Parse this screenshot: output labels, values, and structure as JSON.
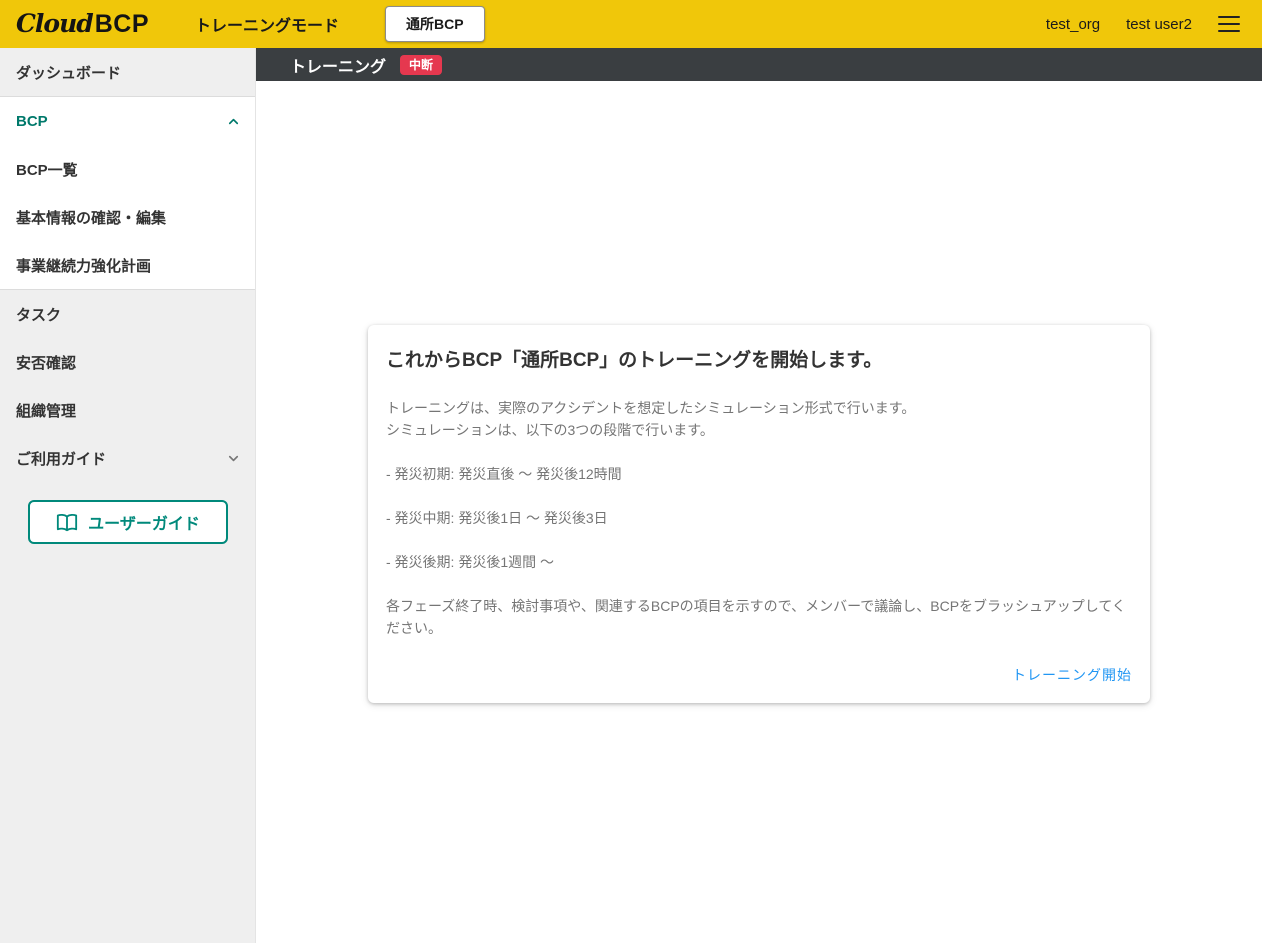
{
  "header": {
    "logo_cloud": "Cloud",
    "logo_bcp": "BCP",
    "mode_label": "トレーニングモード",
    "bcp_button": "通所BCP",
    "org_name": "test_org",
    "user_name": "test user2"
  },
  "sidebar": {
    "items": [
      {
        "label": "ダッシュボード"
      },
      {
        "label": "BCP"
      },
      {
        "label": "BCP一覧"
      },
      {
        "label": "基本情報の確認・編集"
      },
      {
        "label": "事業継続力強化計画"
      },
      {
        "label": "タスク"
      },
      {
        "label": "安否確認"
      },
      {
        "label": "組織管理"
      },
      {
        "label": "ご利用ガイド"
      }
    ],
    "user_guide_button": "ユーザーガイド"
  },
  "main": {
    "page_title": "トレーニング",
    "status_badge": "中断",
    "card": {
      "title": "これからBCP「通所BCP」のトレーニングを開始します。",
      "intro_line1": "トレーニングは、実際のアクシデントを想定したシミュレーション形式で行います。",
      "intro_line2": "シミュレーションは、以下の3つの段階で行います。",
      "phases": [
        "- 発災初期: 発災直後 〜 発災後12時間",
        "- 発災中期: 発災後1日 〜 発災後3日",
        "- 発災後期: 発災後1週間 〜"
      ],
      "outro": "各フェーズ終了時、検討事項や、関連するBCPの項目を示すので、メンバーで議論し、BCPをブラッシュアップしてください。",
      "start_link": "トレーニング開始"
    }
  },
  "colors": {
    "header_bg": "#F0C70A",
    "accent_teal": "#00796B",
    "badge_red": "#E5384F",
    "link_blue": "#2196F3",
    "dark_bar": "#3A3E41",
    "sidebar_bg": "#EFEFEF"
  }
}
